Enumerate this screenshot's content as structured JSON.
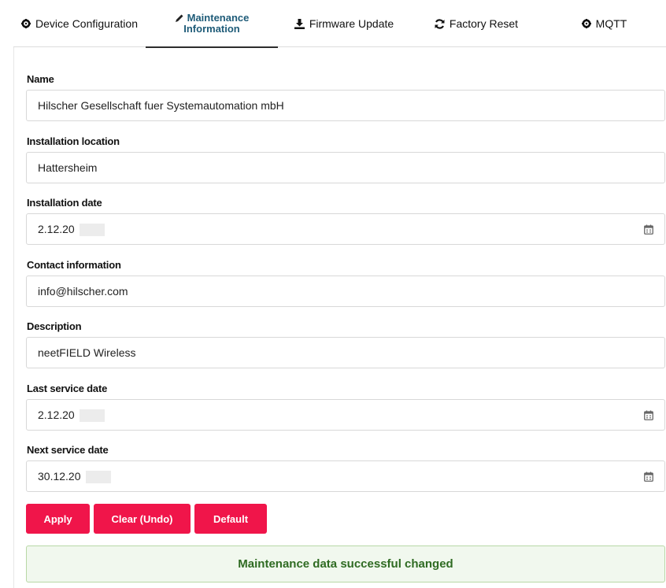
{
  "tabs": {
    "device_configuration": "Device Configuration",
    "maintenance_line1": "Maintenance",
    "maintenance_line2": "Information",
    "firmware_update": "Firmware Update",
    "factory_reset": "Factory Reset",
    "mqtt": "MQTT"
  },
  "form": {
    "name": {
      "label": "Name",
      "value": "Hilscher Gesellschaft fuer Systemautomation mbH"
    },
    "installation_location": {
      "label": "Installation location",
      "value": "Hattersheim"
    },
    "installation_date": {
      "label": "Installation date",
      "value": "2.12.20"
    },
    "contact_information": {
      "label": "Contact information",
      "value": "info@hilscher.com"
    },
    "description": {
      "label": "Description",
      "value": "neetFIELD Wireless"
    },
    "last_service_date": {
      "label": "Last service date",
      "value": "2.12.20"
    },
    "next_service_date": {
      "label": "Next service date",
      "value": "30.12.20"
    }
  },
  "buttons": {
    "apply": "Apply",
    "clear": "Clear (Undo)",
    "default": "Default"
  },
  "status": {
    "message": "Maintenance data successful changed"
  },
  "colors": {
    "accent": "#f0154a",
    "active_tab": "#1e5b78",
    "success_bg": "#f1f8ee",
    "success_text": "#2f6b22"
  }
}
